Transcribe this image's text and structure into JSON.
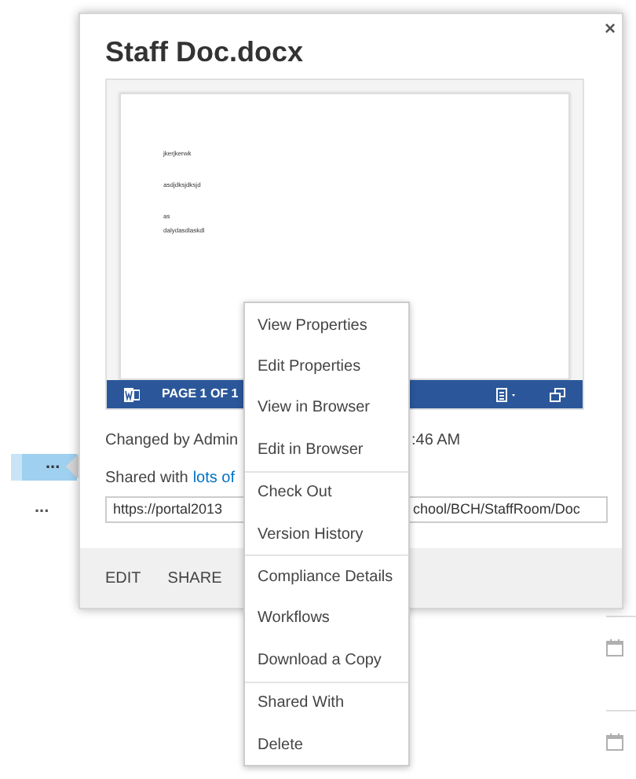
{
  "rows": [
    {
      "label": "...",
      "selected": true
    },
    {
      "label": "...",
      "selected": false
    }
  ],
  "callout": {
    "title": "Staff Doc.docx",
    "close": "×",
    "preview": {
      "lines": [
        "jkerjkerwk",
        "asdjdksjdksjd",
        "as",
        "dalydasdlaskdl"
      ],
      "page_label": "PAGE 1 OF 1"
    },
    "changed": {
      "left": "Changed by Admin",
      "right": ":46 AM"
    },
    "shared": {
      "prefix": "Shared with",
      "link": "lots of"
    },
    "url": {
      "left": "https://portal2013",
      "right": "chool/BCH/StaffRoom/Doc"
    },
    "actions": [
      "EDIT",
      "SHARE"
    ]
  },
  "menu": [
    [
      "View Properties",
      "Edit Properties",
      "View in Browser",
      "Edit in Browser"
    ],
    [
      "Check Out",
      "Version History"
    ],
    [
      "Compliance Details",
      "Workflows",
      "Download a Copy"
    ],
    [
      "Shared With",
      "Delete"
    ]
  ]
}
